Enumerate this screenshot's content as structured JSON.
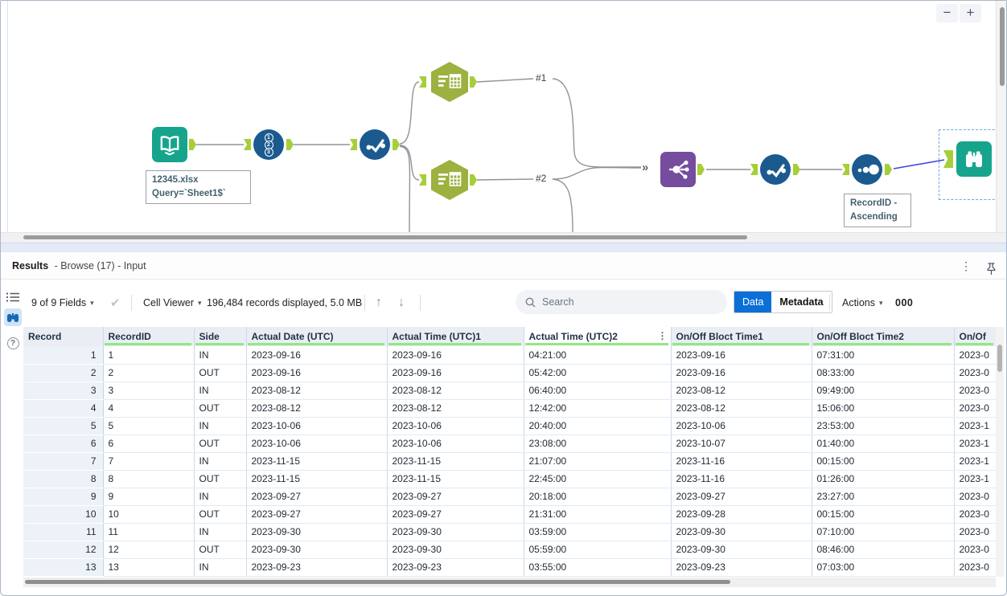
{
  "canvas": {
    "zoom_controls": {
      "zoom_out": "−",
      "zoom_in": "+"
    },
    "annotations": {
      "input_line1": "12345.xlsx",
      "input_line2": "Query=`Sheet1$`",
      "sort_line1": "RecordID -",
      "sort_line2": "Ascending"
    },
    "wire_labels": {
      "branch1": "#1",
      "branch2": "#2"
    },
    "union_input_glyph": "»"
  },
  "results": {
    "title_bold": "Results",
    "title_rest": "- Browse (17) - Input",
    "menu_glyph": "⋮",
    "toolbar": {
      "fields_label": "9 of 9 Fields",
      "apply_glyph": "✔",
      "caret_glyph": "▾",
      "cell_viewer_label": "Cell Viewer",
      "records_summary": "196,484 records displayed, 5.0 MB",
      "up_glyph": "↑",
      "down_glyph": "↓",
      "search_placeholder": "Search",
      "data_tab": "Data",
      "metadata_tab": "Metadata",
      "actions_label": "Actions",
      "overflow_label": "000"
    },
    "table": {
      "columns": [
        "Record",
        "RecordID",
        "Side",
        "Actual Date (UTC)",
        "Actual Time (UTC)1",
        "Actual Time (UTC)2",
        "On/Off Bloct Time1",
        "On/Off Bloct Time2",
        "On/Of"
      ],
      "column_menu_glyph": "⋮",
      "rows": [
        [
          "1",
          "1",
          "IN",
          "2023-09-16",
          "2023-09-16",
          "04:21:00",
          "2023-09-16",
          "07:31:00",
          "2023-0"
        ],
        [
          "2",
          "2",
          "OUT",
          "2023-09-16",
          "2023-09-16",
          "05:42:00",
          "2023-09-16",
          "08:33:00",
          "2023-0"
        ],
        [
          "3",
          "3",
          "IN",
          "2023-08-12",
          "2023-08-12",
          "06:40:00",
          "2023-08-12",
          "09:49:00",
          "2023-0"
        ],
        [
          "4",
          "4",
          "OUT",
          "2023-08-12",
          "2023-08-12",
          "12:42:00",
          "2023-08-12",
          "15:06:00",
          "2023-0"
        ],
        [
          "5",
          "5",
          "IN",
          "2023-10-06",
          "2023-10-06",
          "20:40:00",
          "2023-10-06",
          "23:53:00",
          "2023-1"
        ],
        [
          "6",
          "6",
          "OUT",
          "2023-10-06",
          "2023-10-06",
          "23:08:00",
          "2023-10-07",
          "01:40:00",
          "2023-1"
        ],
        [
          "7",
          "7",
          "IN",
          "2023-11-15",
          "2023-11-15",
          "21:07:00",
          "2023-11-16",
          "00:15:00",
          "2023-1"
        ],
        [
          "8",
          "8",
          "OUT",
          "2023-11-15",
          "2023-11-15",
          "22:45:00",
          "2023-11-16",
          "01:26:00",
          "2023-1"
        ],
        [
          "9",
          "9",
          "IN",
          "2023-09-27",
          "2023-09-27",
          "20:18:00",
          "2023-09-27",
          "23:27:00",
          "2023-0"
        ],
        [
          "10",
          "10",
          "OUT",
          "2023-09-27",
          "2023-09-27",
          "21:31:00",
          "2023-09-28",
          "00:15:00",
          "2023-0"
        ],
        [
          "11",
          "11",
          "IN",
          "2023-09-30",
          "2023-09-30",
          "03:59:00",
          "2023-09-30",
          "07:10:00",
          "2023-0"
        ],
        [
          "12",
          "12",
          "OUT",
          "2023-09-30",
          "2023-09-30",
          "05:59:00",
          "2023-09-30",
          "08:46:00",
          "2023-0"
        ],
        [
          "13",
          "13",
          "IN",
          "2023-09-23",
          "2023-09-23",
          "03:55:00",
          "2023-09-23",
          "07:03:00",
          "2023-0"
        ]
      ]
    }
  },
  "colors": {
    "tool_blue": "#1A5A8F",
    "tool_teal": "#16A58C",
    "tool_olive": "#9CB13F",
    "tool_purple": "#754C9E",
    "anchor_green": "#A6CE39",
    "selected_wire_blue": "#3B49DF",
    "active_tab_blue": "#0C6FD6",
    "quality_bar_green": "#90E880"
  }
}
